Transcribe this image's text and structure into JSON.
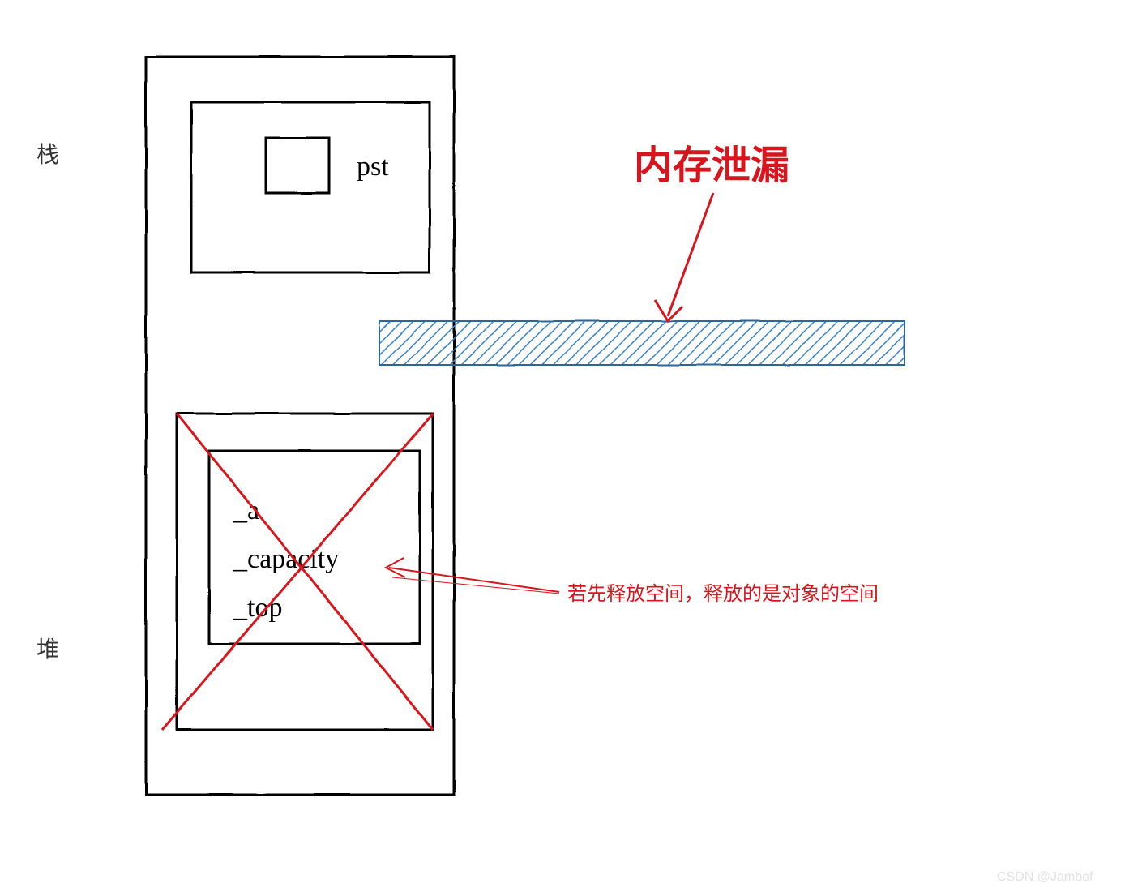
{
  "labels": {
    "stack": "栈",
    "heap": "堆"
  },
  "stackBox": {
    "ptr": "pst"
  },
  "heapBox": {
    "field1": "_a",
    "field2": "_capacity",
    "field3": "_top"
  },
  "callouts": {
    "memoryLeak": "内存泄漏",
    "releaseNote": "若先释放空间，释放的是对象的空间"
  },
  "watermark": "CSDN @Jambof",
  "colors": {
    "stroke": "#000000",
    "red": "#d9141c",
    "hatch": "#3d83c5",
    "hatchBorder": "#2c66a0"
  }
}
